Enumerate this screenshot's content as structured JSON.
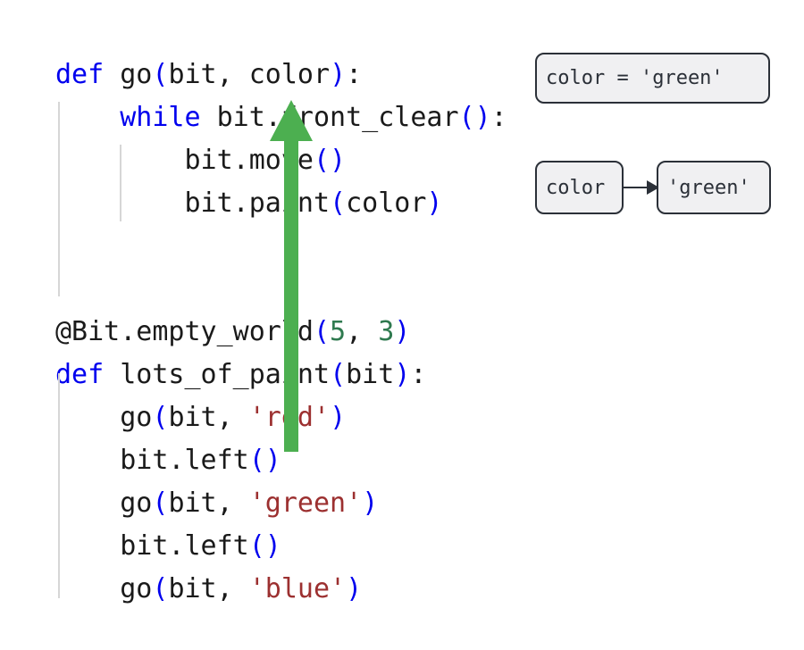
{
  "editor": {
    "background": "#ffffff",
    "colors": {
      "keyword": "#0000ee",
      "punctuation": "#0000ee",
      "string": "#9c3030",
      "number": "#2f7a4f",
      "identifier": "#1a1a1a",
      "indent_guide": "#d6d6d6"
    },
    "lines": [
      {
        "indent": 0,
        "tokens": [
          {
            "t": "def",
            "c": "kw"
          },
          {
            "t": " ",
            "c": "name"
          },
          {
            "t": "go",
            "c": "name"
          },
          {
            "t": "(",
            "c": "punc"
          },
          {
            "t": "bit, color",
            "c": "name"
          },
          {
            "t": ")",
            "c": "punc"
          },
          {
            "t": ":",
            "c": "name"
          }
        ]
      },
      {
        "indent": 0,
        "tokens": [
          {
            "t": "    ",
            "c": "name"
          },
          {
            "t": "while",
            "c": "kw"
          },
          {
            "t": " bit.front_clear",
            "c": "name"
          },
          {
            "t": "()",
            "c": "punc"
          },
          {
            "t": ":",
            "c": "name"
          }
        ]
      },
      {
        "indent": 0,
        "tokens": [
          {
            "t": "        bit.move",
            "c": "name"
          },
          {
            "t": "()",
            "c": "punc"
          }
        ]
      },
      {
        "indent": 0,
        "tokens": [
          {
            "t": "        bit.paint",
            "c": "name"
          },
          {
            "t": "(",
            "c": "punc"
          },
          {
            "t": "color",
            "c": "name"
          },
          {
            "t": ")",
            "c": "punc"
          }
        ]
      },
      {
        "indent": 0,
        "tokens": []
      },
      {
        "indent": 0,
        "tokens": []
      },
      {
        "indent": 0,
        "tokens": [
          {
            "t": "@Bit.empty_world",
            "c": "name"
          },
          {
            "t": "(",
            "c": "punc"
          },
          {
            "t": "5",
            "c": "num"
          },
          {
            "t": ", ",
            "c": "name"
          },
          {
            "t": "3",
            "c": "num"
          },
          {
            "t": ")",
            "c": "punc"
          }
        ]
      },
      {
        "indent": 0,
        "tokens": [
          {
            "t": "def",
            "c": "kw"
          },
          {
            "t": " lots_of_paint",
            "c": "name"
          },
          {
            "t": "(",
            "c": "punc"
          },
          {
            "t": "bit",
            "c": "name"
          },
          {
            "t": ")",
            "c": "punc"
          },
          {
            "t": ":",
            "c": "name"
          }
        ]
      },
      {
        "indent": 0,
        "tokens": [
          {
            "t": "    go",
            "c": "name"
          },
          {
            "t": "(",
            "c": "punc"
          },
          {
            "t": "bit, ",
            "c": "name"
          },
          {
            "t": "'red'",
            "c": "str"
          },
          {
            "t": ")",
            "c": "punc"
          }
        ]
      },
      {
        "indent": 0,
        "tokens": [
          {
            "t": "    bit.left",
            "c": "name"
          },
          {
            "t": "()",
            "c": "punc"
          }
        ]
      },
      {
        "indent": 0,
        "tokens": [
          {
            "t": "    go",
            "c": "name"
          },
          {
            "t": "(",
            "c": "punc"
          },
          {
            "t": "bit, ",
            "c": "name"
          },
          {
            "t": "'green'",
            "c": "str"
          },
          {
            "t": ")",
            "c": "punc"
          }
        ]
      },
      {
        "indent": 0,
        "tokens": [
          {
            "t": "    bit.left",
            "c": "name"
          },
          {
            "t": "()",
            "c": "punc"
          }
        ]
      },
      {
        "indent": 0,
        "tokens": [
          {
            "t": "    go",
            "c": "name"
          },
          {
            "t": "(",
            "c": "punc"
          },
          {
            "t": "bit, ",
            "c": "name"
          },
          {
            "t": "'blue'",
            "c": "str"
          },
          {
            "t": ")",
            "c": "punc"
          }
        ]
      }
    ],
    "plain_text": "def go(bit, color):\n    while bit.front_clear():\n        bit.move()\n        bit.paint(color)\n\n\n@Bit.empty_world(5, 3)\ndef lots_of_paint(bit):\n    go(bit, 'red')\n    bit.left()\n    go(bit, 'green')\n    bit.left()\n    go(bit, 'blue')"
  },
  "annotation": {
    "arrow_color": "#4caf50",
    "arrow_direction": "up",
    "arrow_label": "call-flow-arrow"
  },
  "diagram": {
    "assignment_statement": "color = 'green'",
    "variable_name": "color",
    "variable_value": "'green'",
    "box_fill": "#f0f0f2",
    "box_border": "#2b3038",
    "connector": "points-to-arrow"
  }
}
